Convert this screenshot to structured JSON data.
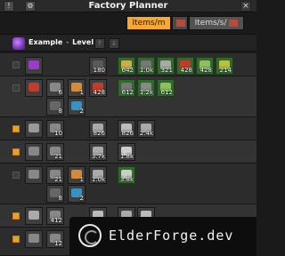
{
  "window": {
    "title": "Factory Planner",
    "close_label": "×",
    "pin_label": "!",
    "tools_label": "⚙"
  },
  "modes": {
    "items_per_minute": "Items/m",
    "items_per_second": "Items/s/",
    "selected": "items_per_minute"
  },
  "subfactory": {
    "name": "Example",
    "separator": "-",
    "level_label": "Level 1",
    "nav_up": "↑",
    "nav_down": "↓"
  },
  "rows": [
    {
      "checked": false,
      "slots": [
        {
          "kind": "product",
          "color": "#9b3cc7",
          "num": ""
        },
        {
          "kind": "product",
          "color": "#5a5a5a",
          "num": "180"
        },
        {
          "kind": "green",
          "color": "#c8b04a",
          "num": "642"
        },
        {
          "kind": "green",
          "color": "#777",
          "num": "1.0k"
        },
        {
          "kind": "green",
          "color": "#aaa",
          "num": "321"
        },
        {
          "kind": "green",
          "color": "#c23b2b",
          "num": "428"
        },
        {
          "kind": "green",
          "color": "#8fbf5f",
          "num": "428"
        },
        {
          "kind": "green",
          "color": "#b5c23a",
          "num": "214"
        }
      ]
    },
    {
      "checked": false,
      "slots": [
        {
          "kind": "dark",
          "color": "#c23b2b",
          "num": ""
        },
        {
          "kind": "dark",
          "color": "#888",
          "num": "6"
        },
        {
          "kind": "dark",
          "color": "#d48a3b",
          "num": "1"
        },
        {
          "kind": "dark",
          "color": "#c23b2b",
          "num": "428"
        },
        {
          "kind": "green",
          "color": "#777",
          "num": "612"
        },
        {
          "kind": "green",
          "color": "#888",
          "num": "1.2k"
        },
        {
          "kind": "green",
          "color": "#8fbf5f",
          "num": "612"
        },
        {
          "kind": "dark",
          "color": "#666",
          "num": "8"
        },
        {
          "kind": "dark",
          "color": "#3a8fc4",
          "num": "2"
        }
      ]
    },
    {
      "checked": true,
      "slots": [
        {
          "kind": "dark",
          "color": "#999",
          "num": ""
        },
        {
          "kind": "dark",
          "color": "#888",
          "num": "10"
        },
        {
          "kind": "dark",
          "color": "#aaa",
          "num": "826"
        },
        {
          "kind": "dark",
          "color": "#bbb",
          "num": "826"
        },
        {
          "kind": "dark",
          "color": "#aaa",
          "num": "2.4k"
        }
      ]
    },
    {
      "checked": true,
      "slots": [
        {
          "kind": "dark",
          "color": "#888",
          "num": ""
        },
        {
          "kind": "dark",
          "color": "#888",
          "num": "21"
        },
        {
          "kind": "dark",
          "color": "#aaa",
          "num": "3.7k"
        },
        {
          "kind": "dark",
          "color": "#ccc",
          "num": "1.8k"
        }
      ]
    },
    {
      "checked": false,
      "slots": [
        {
          "kind": "dark",
          "color": "#888",
          "num": ""
        },
        {
          "kind": "dark",
          "color": "#888",
          "num": "21"
        },
        {
          "kind": "dark",
          "color": "#d48a3b",
          "num": "1"
        },
        {
          "kind": "dark",
          "color": "#aaa",
          "num": "1.0k"
        },
        {
          "kind": "green",
          "color": "#ccc",
          "num": "3.8k"
        },
        {
          "kind": "dark",
          "color": "#666",
          "num": "8"
        },
        {
          "kind": "dark",
          "color": "#3a8fc4",
          "num": "2"
        }
      ]
    },
    {
      "checked": true,
      "slots": [
        {
          "kind": "dark",
          "color": "#aaa",
          "num": ""
        },
        {
          "kind": "dark",
          "color": "#888",
          "num": "412"
        },
        {
          "kind": "dark",
          "color": "#bbb",
          "num": "428"
        },
        {
          "kind": "dark",
          "color": "#aaa",
          "num": "963"
        },
        {
          "kind": "dark",
          "color": "#bbb",
          "num": "5.1"
        }
      ]
    },
    {
      "checked": true,
      "slots": [
        {
          "kind": "dark",
          "color": "#888",
          "num": ""
        },
        {
          "kind": "dark",
          "color": "#888",
          "num": "12"
        }
      ]
    }
  ],
  "watermark": {
    "text": "ElderForge.dev"
  }
}
